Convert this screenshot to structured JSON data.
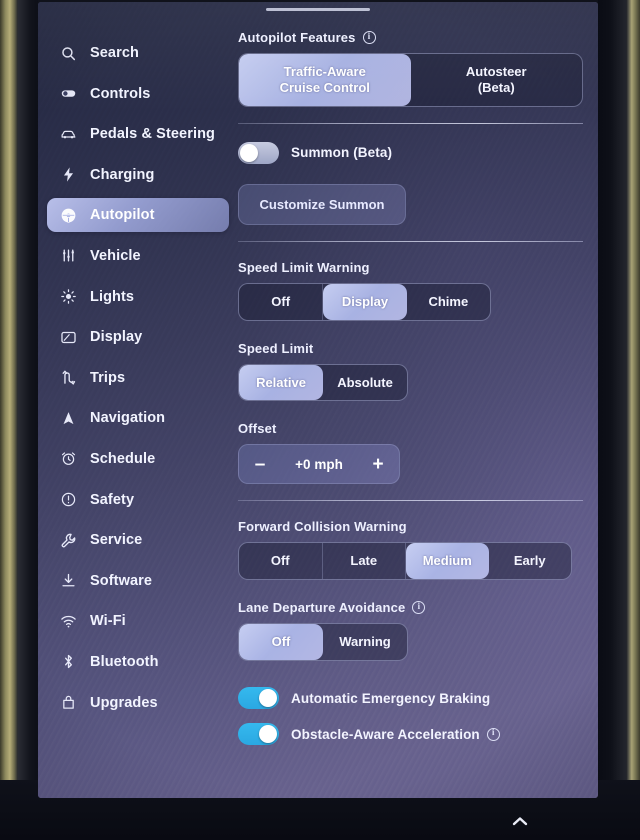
{
  "device": {
    "screen_kind": "tesla-touchscreen",
    "accent_selected": "#c3cbf6",
    "accent_toggle_on": "#2fb4ec",
    "panel_background": "#3a3d62"
  },
  "sidebar": {
    "items": [
      {
        "label": "Search",
        "icon": "search-icon",
        "selected": false
      },
      {
        "label": "Controls",
        "icon": "toggle-switch-icon",
        "selected": false
      },
      {
        "label": "Pedals & Steering",
        "icon": "car-icon",
        "selected": false
      },
      {
        "label": "Charging",
        "icon": "lightning-bolt-icon",
        "selected": false
      },
      {
        "label": "Autopilot",
        "icon": "steering-wheel-icon",
        "selected": true
      },
      {
        "label": "Vehicle",
        "icon": "sliders-icon",
        "selected": false
      },
      {
        "label": "Lights",
        "icon": "sun-icon",
        "selected": false
      },
      {
        "label": "Display",
        "icon": "display-icon",
        "selected": false
      },
      {
        "label": "Trips",
        "icon": "route-icon",
        "selected": false
      },
      {
        "label": "Navigation",
        "icon": "navigation-arrow-icon",
        "selected": false
      },
      {
        "label": "Schedule",
        "icon": "alarm-clock-icon",
        "selected": false
      },
      {
        "label": "Safety",
        "icon": "exclamation-circle-icon",
        "selected": false
      },
      {
        "label": "Service",
        "icon": "wrench-icon",
        "selected": false
      },
      {
        "label": "Software",
        "icon": "download-icon",
        "selected": false
      },
      {
        "label": "Wi-Fi",
        "icon": "wifi-icon",
        "selected": false
      },
      {
        "label": "Bluetooth",
        "icon": "bluetooth-icon",
        "selected": false
      },
      {
        "label": "Upgrades",
        "icon": "bag-icon",
        "selected": false
      }
    ]
  },
  "autopilot": {
    "features": {
      "label": "Autopilot Features",
      "info": "i",
      "options": [
        "Traffic-Aware\nCruise Control",
        "Autosteer\n(Beta)"
      ],
      "selected_index": 0
    },
    "summon": {
      "label": "Summon (Beta)",
      "enabled": false,
      "customize_label": "Customize Summon"
    },
    "speed_limit_warning": {
      "label": "Speed Limit Warning",
      "options": [
        "Off",
        "Display",
        "Chime"
      ],
      "selected_index": 1
    },
    "speed_limit": {
      "label": "Speed Limit",
      "options": [
        "Relative",
        "Absolute"
      ],
      "selected_index": 0
    },
    "offset": {
      "label": "Offset",
      "value": "+0 mph",
      "minus": "–",
      "plus": "+"
    },
    "forward_collision_warning": {
      "label": "Forward Collision Warning",
      "options": [
        "Off",
        "Late",
        "Medium",
        "Early"
      ],
      "selected_index": 2
    },
    "lane_departure_avoidance": {
      "label": "Lane Departure Avoidance",
      "info": "i",
      "options": [
        "Off",
        "Warning"
      ],
      "selected_index": 0
    },
    "automatic_emergency_braking": {
      "label": "Automatic Emergency Braking",
      "enabled": true
    },
    "obstacle_aware_acceleration": {
      "label": "Obstacle-Aware Acceleration",
      "info": "i",
      "enabled": true
    }
  }
}
